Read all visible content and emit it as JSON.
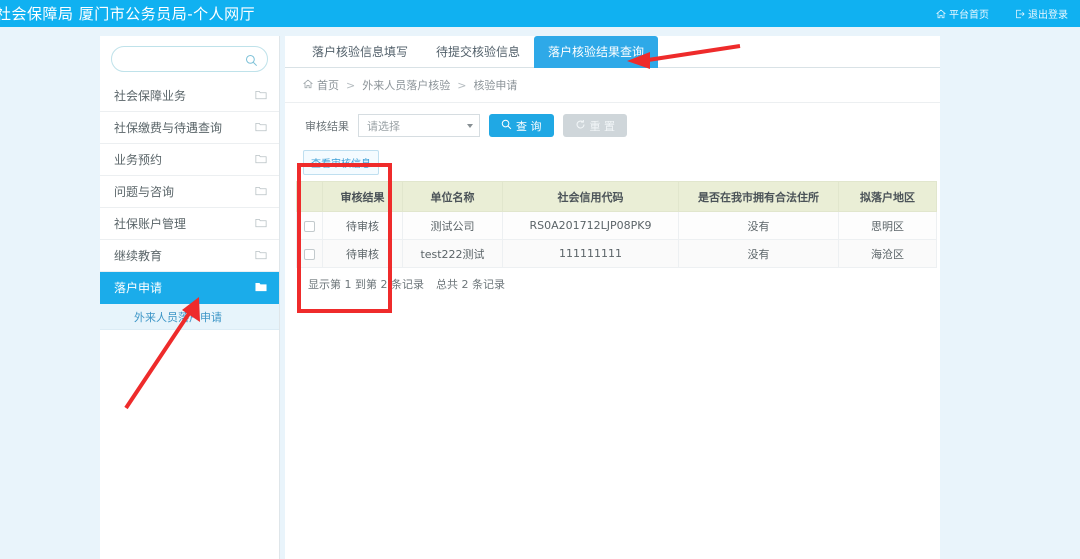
{
  "header": {
    "brand": "社会保障局 厦门市公务员局-个人网厅",
    "links": [
      {
        "label": "平台首页",
        "icon": "home-icon"
      },
      {
        "label": "退出登录",
        "icon": "logout-icon"
      }
    ]
  },
  "sidebar": {
    "search": {
      "value": "",
      "placeholder": "",
      "icon": "search-icon"
    },
    "items": [
      {
        "label": "社会保障业务",
        "icon": "folder-icon",
        "active": false
      },
      {
        "label": "社保缴费与待遇查询",
        "icon": "folder-icon",
        "active": false
      },
      {
        "label": "业务预约",
        "icon": "folder-icon",
        "active": false
      },
      {
        "label": "问题与咨询",
        "icon": "folder-icon",
        "active": false
      },
      {
        "label": "社保账户管理",
        "icon": "folder-icon",
        "active": false
      },
      {
        "label": "继续教育",
        "icon": "folder-icon",
        "active": false
      },
      {
        "label": "落户申请",
        "icon": "folder-open-icon",
        "active": true
      }
    ],
    "submenu": [
      {
        "label": "外来人员落户申请"
      }
    ]
  },
  "main": {
    "tabs": [
      {
        "label": "落户核验信息填写",
        "active": false
      },
      {
        "label": "待提交核验信息",
        "active": false
      },
      {
        "label": "落户核验结果查询",
        "active": true
      }
    ],
    "breadcrumb": {
      "home_icon": "home-icon",
      "crumbs": [
        "首页",
        "外来人员落户核验",
        "核验申请"
      ],
      "separator": ">"
    },
    "filter": {
      "label": "审核结果",
      "select_value": "请选择",
      "query_button": "查 询",
      "query_icon": "search-icon",
      "reset_button": "重 置",
      "reset_icon": "refresh-icon"
    },
    "action_button": "查看审核信息",
    "table": {
      "columns": [
        "审核结果",
        "单位名称",
        "社会信用代码",
        "是否在我市拥有合法住所",
        "拟落户地区"
      ],
      "rows": [
        {
          "status": "待审核",
          "unit": "测试公司",
          "code": "RS0A201712LJP08PK9",
          "house": "没有",
          "area": "思明区"
        },
        {
          "status": "待审核",
          "unit": "test222测试",
          "code": "111111111",
          "house": "没有",
          "area": "海沧区"
        }
      ]
    },
    "pager": {
      "range_text": "显示第 1 到第 2 条记录",
      "total_text": "总共 2 条记录"
    }
  },
  "colors": {
    "header_blue": "#10b1f1",
    "accent_blue": "#2ea9e8",
    "table_header": "#eaeed6",
    "status_red": "#e0686e",
    "annotation_red": "#ef2b2b",
    "page_bg": "#e9f4fb"
  }
}
